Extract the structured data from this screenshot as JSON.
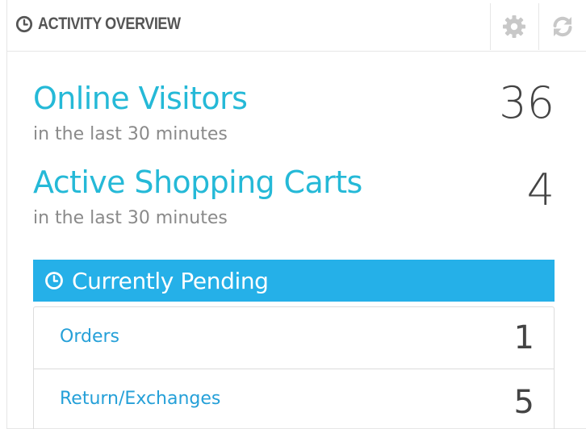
{
  "widget": {
    "title": "ACTIVITY OVERVIEW",
    "title_icon": "clock-icon",
    "actions": [
      {
        "name": "configure",
        "icon": "gear-icon"
      },
      {
        "name": "refresh",
        "icon": "refresh-icon"
      }
    ]
  },
  "kpis": {
    "online_visitors": {
      "label": "Online Visitors",
      "subtitle": "in the last 30 minutes",
      "value": "36"
    },
    "active_carts": {
      "label": "Active Shopping Carts",
      "subtitle": "in the last 30 minutes",
      "value": "4"
    }
  },
  "pending": {
    "title": "Currently Pending",
    "title_icon": "clock-icon",
    "items": [
      {
        "label": "Orders",
        "value": "1"
      },
      {
        "label": "Return/Exchanges",
        "value": "5"
      }
    ]
  },
  "colors": {
    "accent": "#25b9d7",
    "pending_header_bg": "#25b0e8",
    "link": "#25a0d8",
    "value_text": "#444444",
    "muted_text": "#8a8a8a",
    "icon_gray": "#c8c8c8"
  }
}
